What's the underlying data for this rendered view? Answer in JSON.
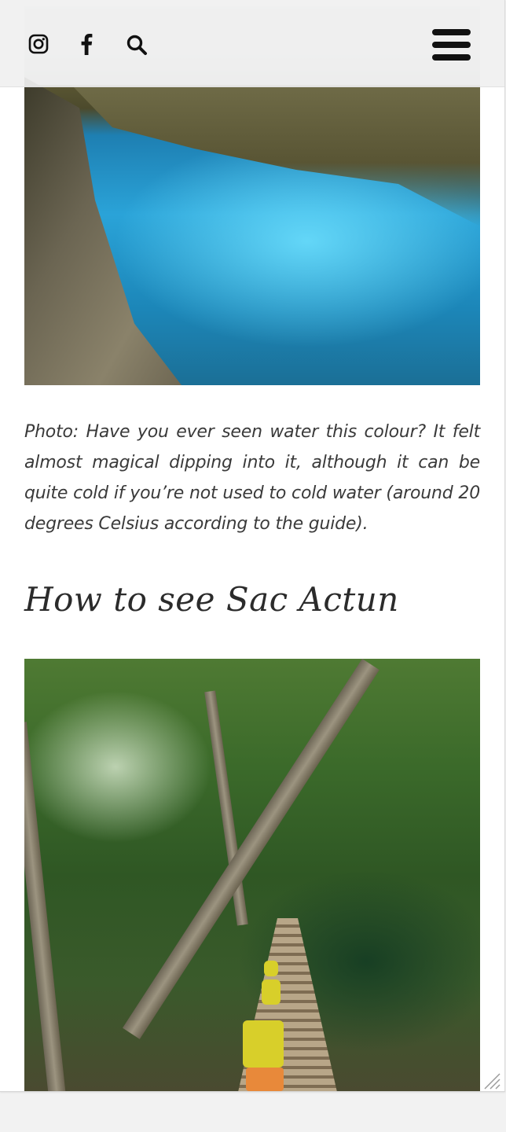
{
  "header": {
    "icons": [
      "instagram-icon",
      "facebook-icon",
      "search-icon",
      "hamburger-menu-icon"
    ]
  },
  "article": {
    "photo_caption": "Photo: Have you ever seen water this colour? It felt almost magical dipping into it, although it can be quite cold if you’re not used to cold water (around 20 degrees Celsius according to the guide).",
    "section_heading": "How to see Sac Actun"
  },
  "colors": {
    "page_background": "#ffffff",
    "outer_background": "#f2f2f2",
    "text": "#3a3a3a",
    "heading": "#2b2b2b",
    "icon": "#111111"
  }
}
